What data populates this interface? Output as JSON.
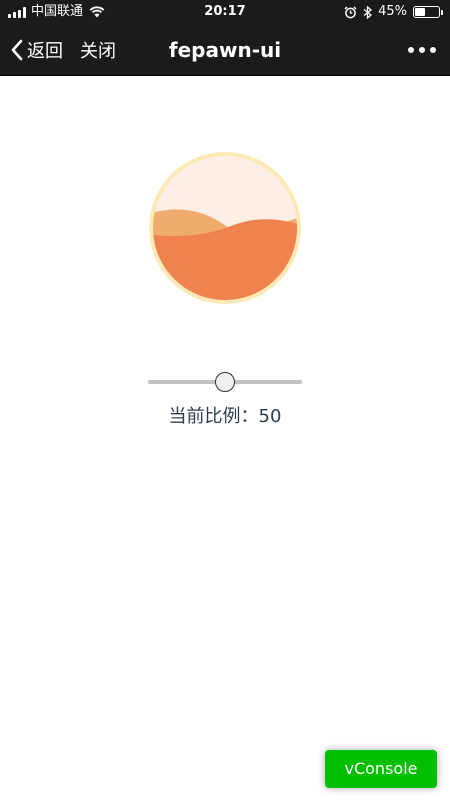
{
  "status_bar": {
    "carrier": "中国联通",
    "time": "20:17",
    "battery": "45%",
    "battery_level": 0.45
  },
  "nav": {
    "back_label": "返回",
    "close_label": "关闭",
    "title": "fepawn-ui"
  },
  "wave": {
    "percent": 50,
    "colors": {
      "border": "#fde9b5",
      "background": "#fdeee6",
      "front_wave": "#ef824f",
      "back_wave": "#f0ab6e"
    }
  },
  "slider": {
    "value": 50,
    "min": 0,
    "max": 100
  },
  "ratio": {
    "label": "当前比例：",
    "value": "50"
  },
  "vconsole": {
    "label": "vConsole",
    "color": "#04be02"
  }
}
